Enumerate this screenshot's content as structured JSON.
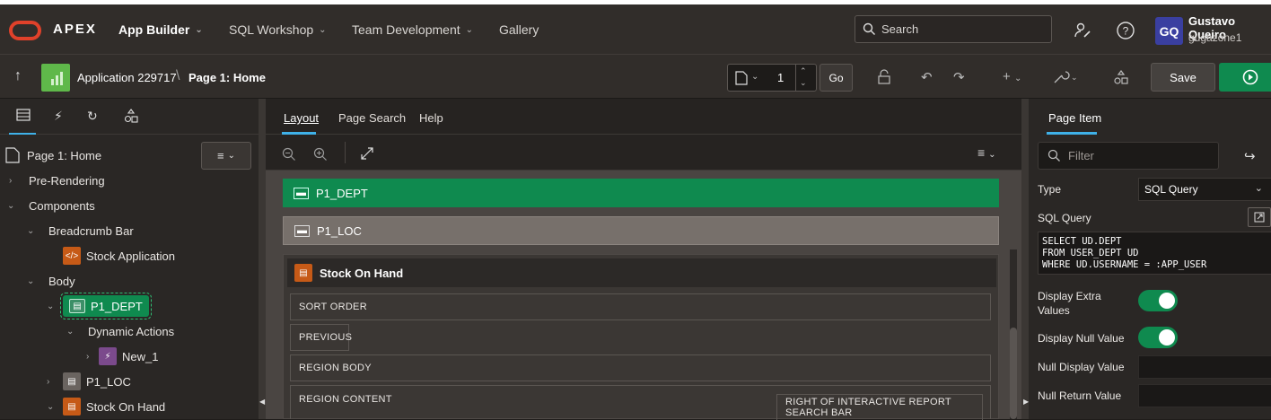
{
  "topnav": {
    "brand": "APEX",
    "items": [
      {
        "label": "App Builder"
      },
      {
        "label": "SQL Workshop"
      },
      {
        "label": "Team Development"
      },
      {
        "label": "Gallery"
      }
    ],
    "search_label": "Search",
    "user_initials": "GQ",
    "user_name": "Gustavo Queiro",
    "user_workspace": "gugazone1"
  },
  "toolbar": {
    "app_label": "Application 229717",
    "page_label": "Page 1: Home",
    "page_number": "1",
    "go_label": "Go",
    "save_label": "Save"
  },
  "left_tree": {
    "page_node": "Page 1: Home",
    "nodes": {
      "pre_rendering": "Pre-Rendering",
      "components": "Components",
      "breadcrumb_bar": "Breadcrumb Bar",
      "stock_application": "Stock Application",
      "body": "Body",
      "p1_dept": "P1_DEPT",
      "dynamic_actions": "Dynamic Actions",
      "new_1": "New_1",
      "p1_loc": "P1_LOC",
      "stock_on_hand": "Stock On Hand"
    }
  },
  "middle": {
    "tabs": [
      "Layout",
      "Page Search",
      "Help"
    ],
    "items": {
      "p1_dept": "P1_DEPT",
      "p1_loc": "P1_LOC",
      "region_title": "Stock On Hand",
      "sort_order": "SORT ORDER",
      "previous": "PREVIOUS",
      "region_body": "REGION BODY",
      "region_content": "REGION CONTENT",
      "right_of_ir": "RIGHT OF INTERACTIVE REPORT SEARCH BAR"
    }
  },
  "right": {
    "tab": "Page Item",
    "filter_placeholder": "Filter",
    "type_label": "Type",
    "type_value": "SQL Query",
    "sql_label": "SQL Query",
    "sql_text": "SELECT UD.DEPT\nFROM USER_DEPT UD\nWHERE UD.USERNAME = :APP_USER",
    "display_extra_label": "Display Extra Values",
    "display_null_label": "Display Null Value",
    "null_display_label": "Null Display Value",
    "null_return_label": "Null Return Value"
  },
  "colors": {
    "accent_green": "#0f8a4f",
    "brand_red": "#e0412a",
    "tab_blue": "#3fb1e8"
  }
}
